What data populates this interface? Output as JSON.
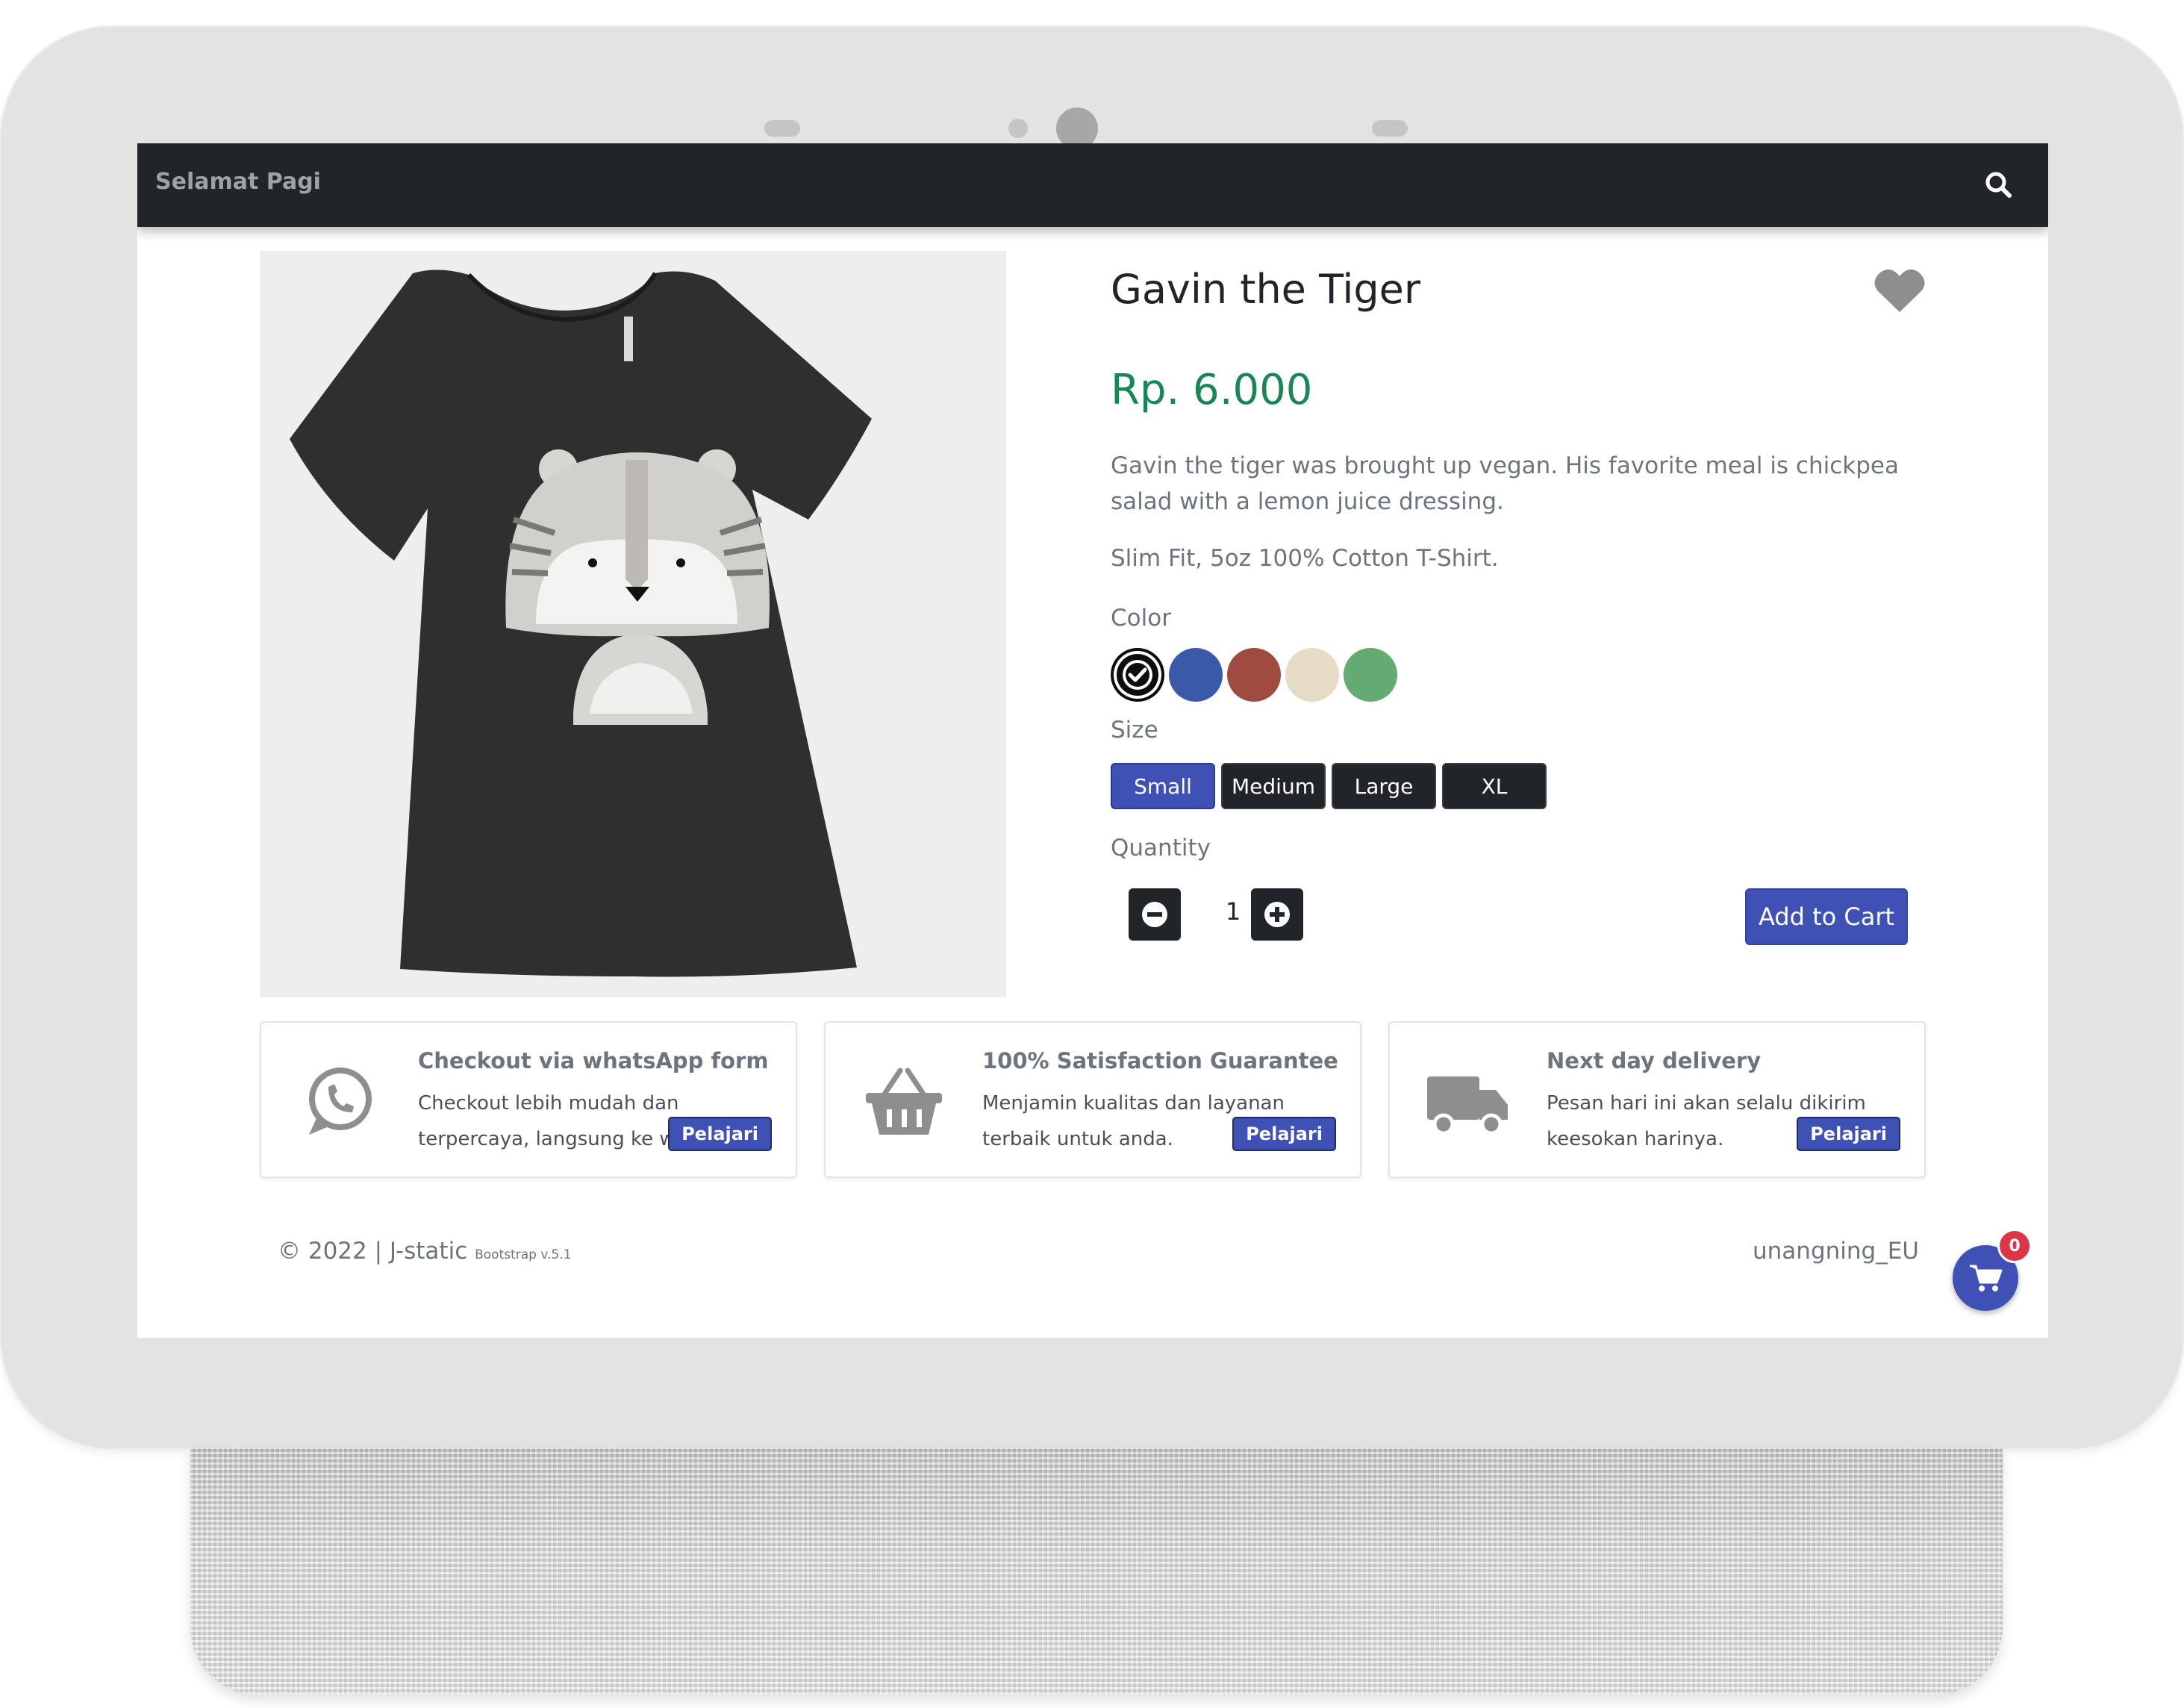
{
  "navbar": {
    "brand": "Selamat Pagi",
    "search_icon": "search-icon"
  },
  "product": {
    "title": "Gavin the Tiger",
    "price": "Rp. 6.000",
    "description": "Gavin the tiger was brought up vegan. His favorite meal is chickpea salad with a lemon juice dressing.",
    "fabric": "Slim Fit, 5oz 100% Cotton T-Shirt.",
    "favorite_icon": "heart-icon",
    "image_alt_icon": "tshirt-tiger-image"
  },
  "color_section": {
    "label": "Color",
    "swatches": [
      {
        "name": "black",
        "hex": "#0d0d0d",
        "selected": true
      },
      {
        "name": "blue",
        "hex": "#3a59a8",
        "selected": false
      },
      {
        "name": "red",
        "hex": "#a04b40",
        "selected": false
      },
      {
        "name": "cream",
        "hex": "#e6dbc6",
        "selected": false
      },
      {
        "name": "green",
        "hex": "#63ab72",
        "selected": false
      }
    ]
  },
  "size_section": {
    "label": "Size",
    "options": [
      "Small",
      "Medium",
      "Large",
      "XL"
    ],
    "selected": "Small"
  },
  "quantity_section": {
    "label": "Quantity",
    "value": "1",
    "minus_icon": "minus-circle-icon",
    "plus_icon": "plus-circle-icon"
  },
  "add_to_cart_label": "Add to Cart",
  "features": [
    {
      "icon": "whatsapp-icon",
      "title": "Checkout via whatsApp form",
      "text": "Checkout lebih mudah dan terpercaya, langsung ke whatsapp.",
      "button": "Pelajari"
    },
    {
      "icon": "basket-icon",
      "title": "100% Satisfaction Guarantee",
      "text": "Menjamin kualitas dan layanan terbaik untuk anda.",
      "button": "Pelajari"
    },
    {
      "icon": "truck-icon",
      "title": "Next day delivery",
      "text": "Pesan hari ini akan selalu dikirim keesokan harinya.",
      "button": "Pelajari"
    }
  ],
  "footer": {
    "copyright": "© 2022 | J-static",
    "version": "Bootstrap v.5.1",
    "author": "unangning_EU"
  },
  "cart": {
    "count": "0",
    "icon": "cart-icon"
  },
  "colors": {
    "navbar_bg": "#212529",
    "primary": "#3f51b5",
    "price_green": "#198754",
    "badge_red": "#dc3545",
    "muted_text": "#6c757d"
  }
}
